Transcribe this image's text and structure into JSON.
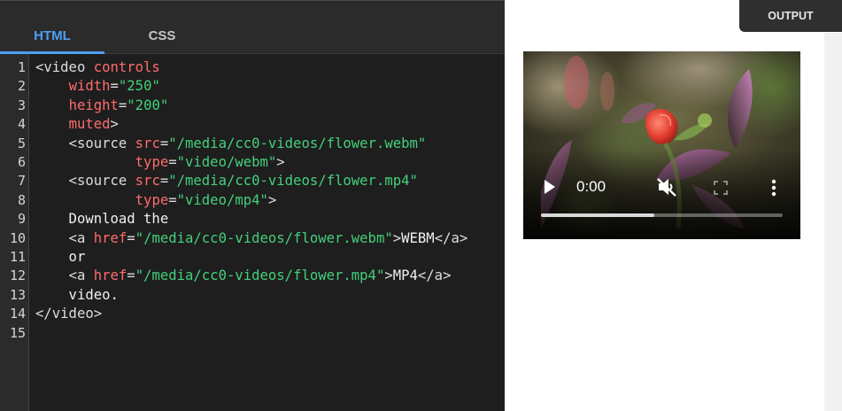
{
  "tabs": [
    {
      "label": "HTML",
      "active": true
    },
    {
      "label": "CSS",
      "active": false
    }
  ],
  "output_button": "OUTPUT",
  "line_numbers": [
    "1",
    "2",
    "3",
    "4",
    "5",
    "6",
    "7",
    "8",
    "9",
    "10",
    "11",
    "12",
    "13",
    "14",
    "15"
  ],
  "code_lines": [
    [
      {
        "t": "tag",
        "v": "<video "
      },
      {
        "t": "attr",
        "v": "controls"
      }
    ],
    [
      {
        "t": "text",
        "v": "    "
      },
      {
        "t": "attr",
        "v": "width"
      },
      {
        "t": "tag",
        "v": "="
      },
      {
        "t": "str",
        "v": "\"250\""
      }
    ],
    [
      {
        "t": "text",
        "v": "    "
      },
      {
        "t": "attr",
        "v": "height"
      },
      {
        "t": "tag",
        "v": "="
      },
      {
        "t": "str",
        "v": "\"200\""
      }
    ],
    [
      {
        "t": "text",
        "v": "    "
      },
      {
        "t": "attr",
        "v": "muted"
      },
      {
        "t": "tag",
        "v": ">"
      }
    ],
    [
      {
        "t": "text",
        "v": "    "
      },
      {
        "t": "tag",
        "v": "<source "
      },
      {
        "t": "attr",
        "v": "src"
      },
      {
        "t": "tag",
        "v": "="
      },
      {
        "t": "str",
        "v": "\"/media/cc0-videos/flower.webm\""
      }
    ],
    [
      {
        "t": "text",
        "v": "            "
      },
      {
        "t": "attr",
        "v": "type"
      },
      {
        "t": "tag",
        "v": "="
      },
      {
        "t": "str",
        "v": "\"video/webm\""
      },
      {
        "t": "tag",
        "v": ">"
      }
    ],
    [
      {
        "t": "text",
        "v": "    "
      },
      {
        "t": "tag",
        "v": "<source "
      },
      {
        "t": "attr",
        "v": "src"
      },
      {
        "t": "tag",
        "v": "="
      },
      {
        "t": "str",
        "v": "\"/media/cc0-videos/flower.mp4\""
      }
    ],
    [
      {
        "t": "text",
        "v": "            "
      },
      {
        "t": "attr",
        "v": "type"
      },
      {
        "t": "tag",
        "v": "="
      },
      {
        "t": "str",
        "v": "\"video/mp4\""
      },
      {
        "t": "tag",
        "v": ">"
      }
    ],
    [
      {
        "t": "text",
        "v": "    Download the"
      }
    ],
    [
      {
        "t": "text",
        "v": "    "
      },
      {
        "t": "tag",
        "v": "<a "
      },
      {
        "t": "attr",
        "v": "href"
      },
      {
        "t": "tag",
        "v": "="
      },
      {
        "t": "str",
        "v": "\"/media/cc0-videos/flower.webm\""
      },
      {
        "t": "tag",
        "v": ">"
      },
      {
        "t": "text",
        "v": "WEBM"
      },
      {
        "t": "tag",
        "v": "</a>"
      }
    ],
    [
      {
        "t": "text",
        "v": "    or"
      }
    ],
    [
      {
        "t": "text",
        "v": "    "
      },
      {
        "t": "tag",
        "v": "<a "
      },
      {
        "t": "attr",
        "v": "href"
      },
      {
        "t": "tag",
        "v": "="
      },
      {
        "t": "str",
        "v": "\"/media/cc0-videos/flower.mp4\""
      },
      {
        "t": "tag",
        "v": ">"
      },
      {
        "t": "text",
        "v": "MP4"
      },
      {
        "t": "tag",
        "v": "</a>"
      }
    ],
    [
      {
        "t": "text",
        "v": "    video."
      }
    ],
    [
      {
        "t": "tag",
        "v": "</video>"
      }
    ],
    []
  ],
  "video_player": {
    "time": "0:00",
    "progress_fraction": 0.47,
    "icons": {
      "play": "play-icon",
      "mute": "muted-speaker-icon",
      "fullscreen": "fullscreen-icon",
      "more": "more-options-icon"
    }
  },
  "colors": {
    "accent": "#4f9ff7",
    "attr": "#ff6b6b",
    "string": "#44d07b",
    "editor_bg": "#1e1e1e"
  }
}
